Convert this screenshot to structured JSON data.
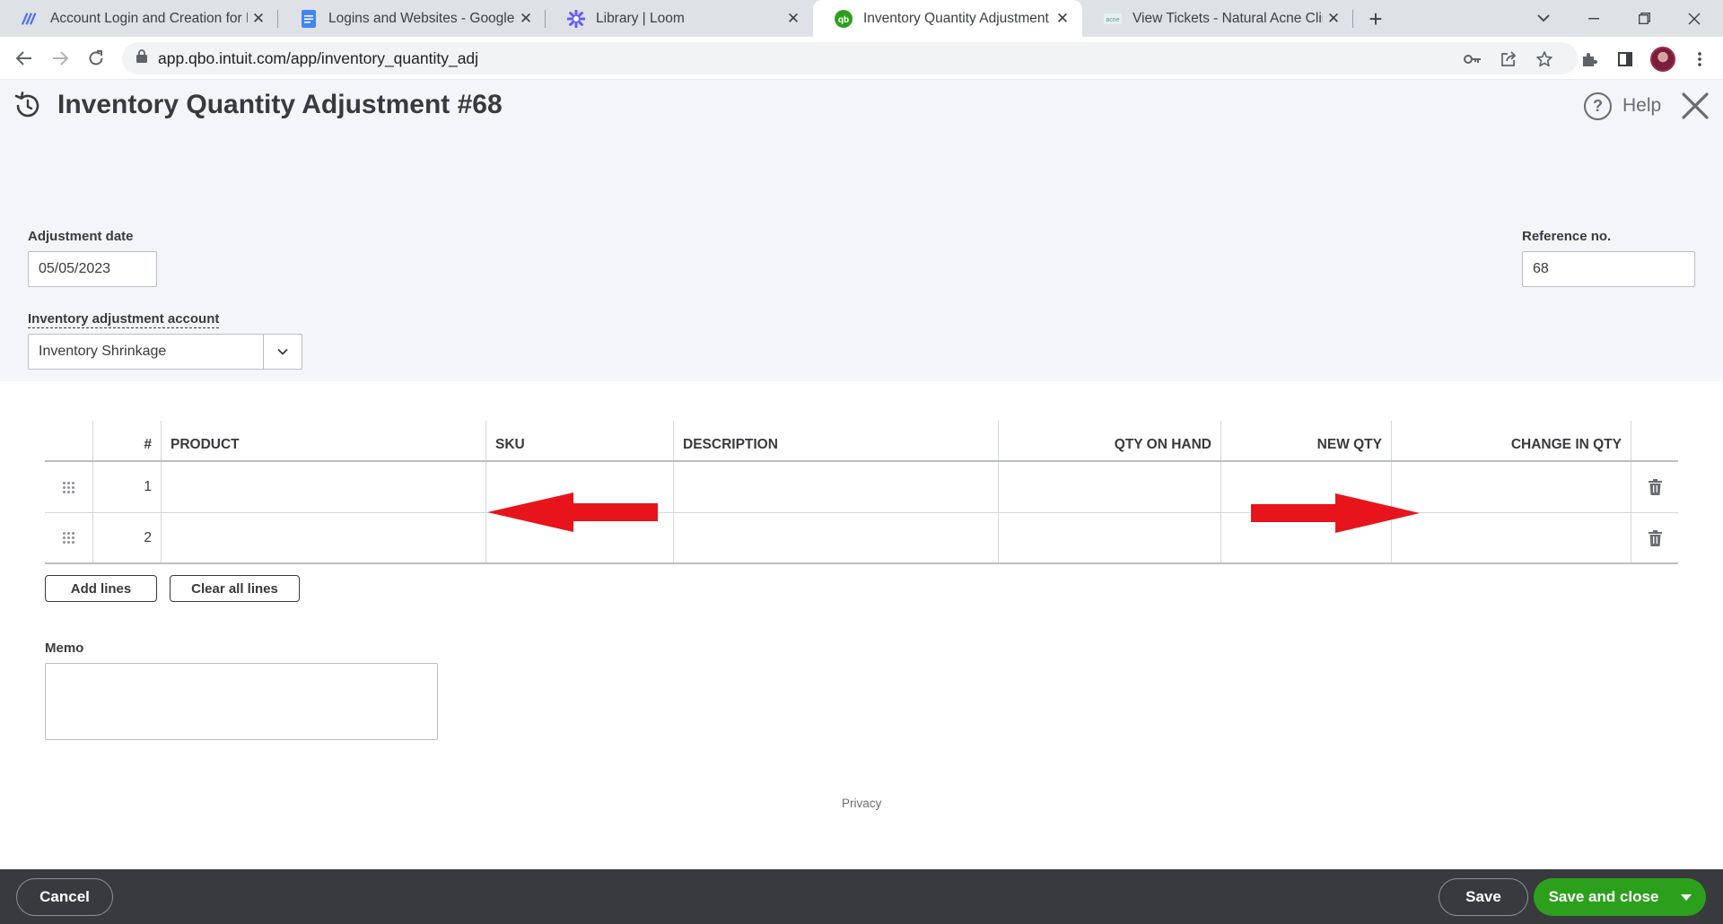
{
  "browser": {
    "tabs": [
      {
        "title": "Account Login and Creation for F",
        "icon": "workflow-logo-icon",
        "active": false
      },
      {
        "title": "Logins and Websites - Google Dc",
        "icon": "google-docs-icon",
        "active": false
      },
      {
        "title": "Library | Loom",
        "icon": "loom-icon",
        "active": false
      },
      {
        "title": "Inventory Quantity Adjustment",
        "icon": "quickbooks-icon",
        "active": true
      },
      {
        "title": "View Tickets - Natural Acne Clinic",
        "icon": "clinic-favicon-icon",
        "active": false
      }
    ],
    "url": "app.qbo.intuit.com/app/inventory_quantity_adj"
  },
  "page": {
    "title": "Inventory Quantity Adjustment #68",
    "help_label": "Help"
  },
  "form": {
    "adjustment_date_label": "Adjustment date",
    "adjustment_date_value": "05/05/2023",
    "reference_label": "Reference no.",
    "reference_value": "68",
    "account_label": "Inventory adjustment account",
    "account_value": "Inventory Shrinkage"
  },
  "table": {
    "headers": {
      "num": "#",
      "product": "PRODUCT",
      "sku": "SKU",
      "description": "DESCRIPTION",
      "qty_on_hand": "QTY ON HAND",
      "new_qty": "NEW QTY",
      "change_in_qty": "CHANGE IN QTY"
    },
    "rows": [
      {
        "num": "1",
        "product": "",
        "sku": "",
        "description": "",
        "qty_on_hand": "",
        "new_qty": "",
        "change_in_qty": ""
      },
      {
        "num": "2",
        "product": "",
        "sku": "",
        "description": "",
        "qty_on_hand": "",
        "new_qty": "",
        "change_in_qty": ""
      }
    ],
    "add_lines_label": "Add lines",
    "clear_lines_label": "Clear all lines"
  },
  "memo": {
    "label": "Memo",
    "value": ""
  },
  "privacy_label": "Privacy",
  "footer": {
    "cancel_label": "Cancel",
    "save_label": "Save",
    "save_close_label": "Save and close"
  },
  "colors": {
    "primary_green": "#2ca01c",
    "footer_bg": "#393a3d",
    "annotation_arrow": "#e8141b",
    "page_bg": "#f4f5f8"
  }
}
